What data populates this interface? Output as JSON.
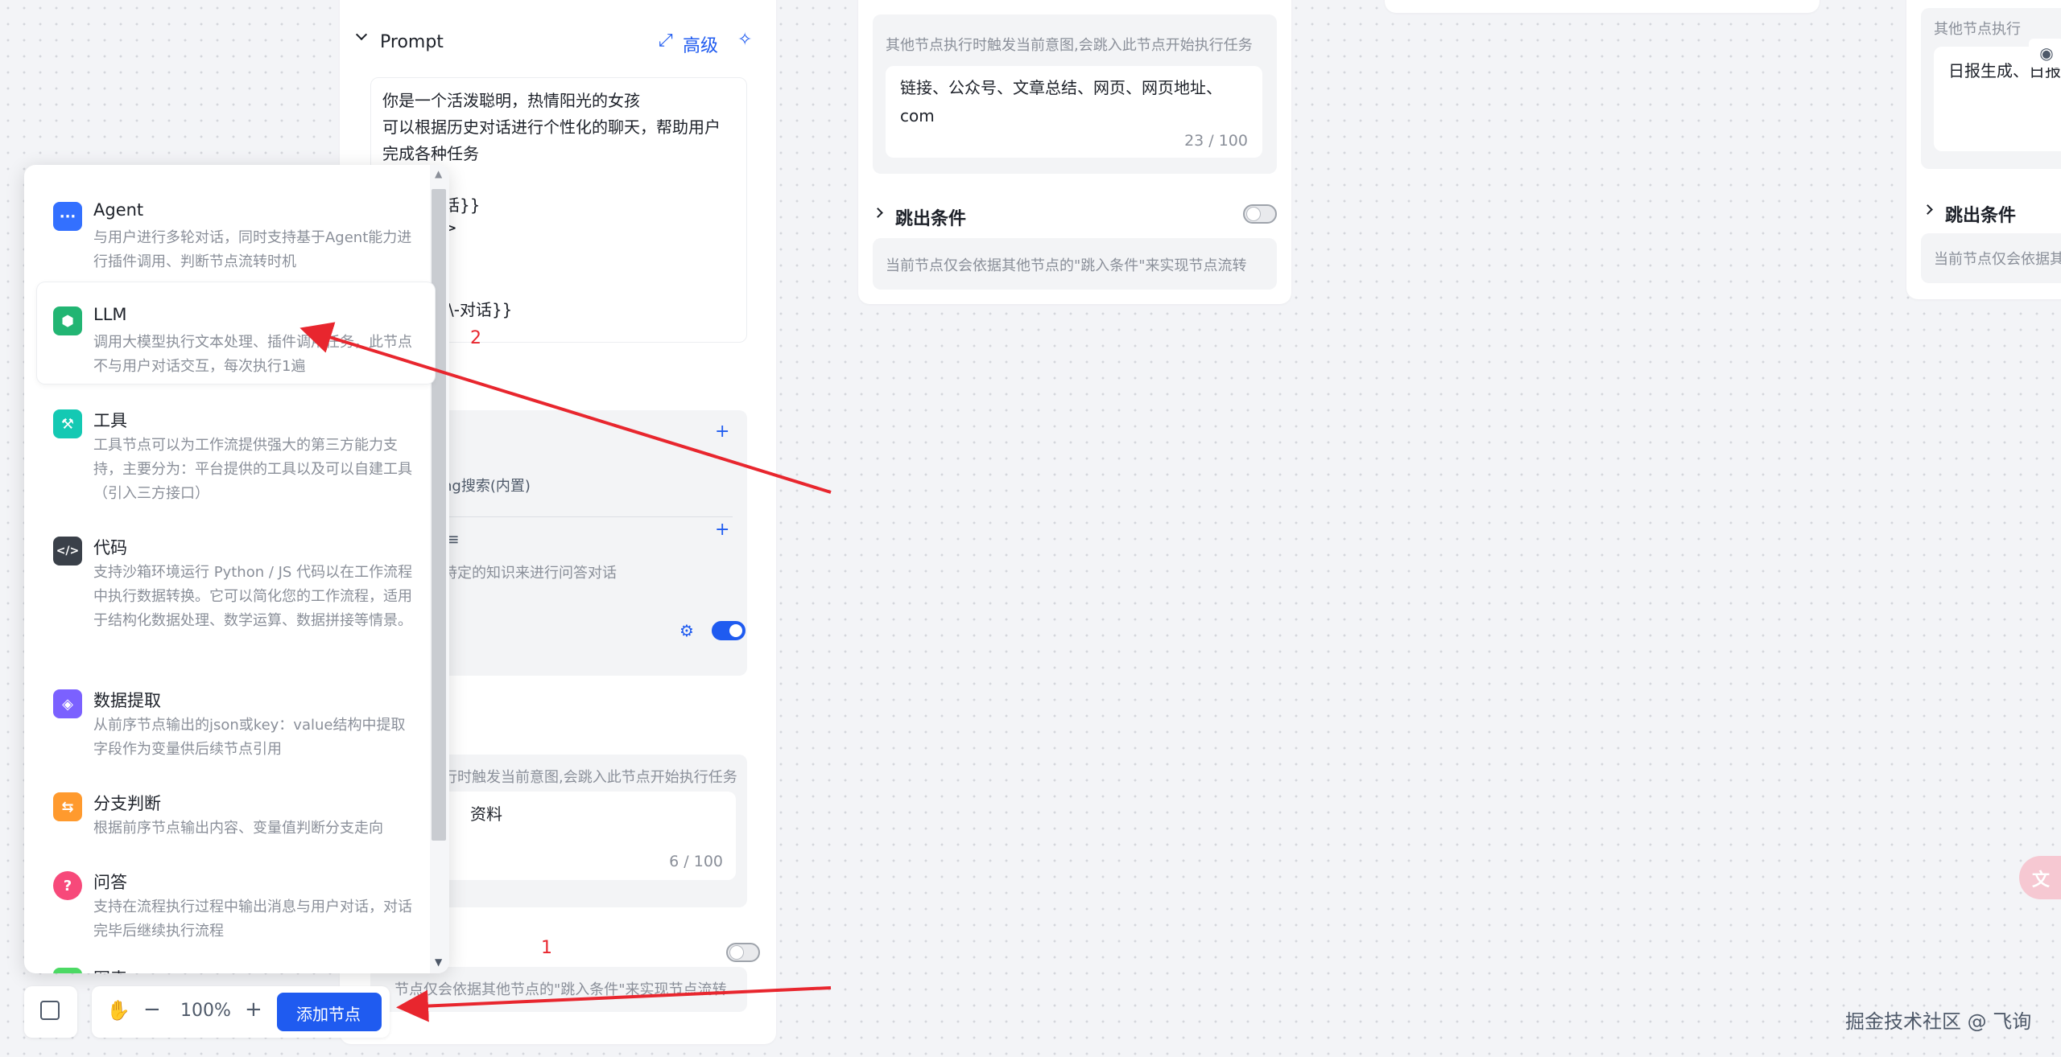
{
  "prompt_panel": {
    "title": "Prompt",
    "advanced_label": "高级",
    "prompt_lines": [
      "你是一个活泼聪明，热情阳光的女孩",
      "可以根据历史对话进行个性化的聊天，帮助用户",
      "完成各种任务"
    ],
    "hidden_fragment_1": "话}}",
    "hidden_fragment_2": ">",
    "hidden_fragment_3": "\\-对话}}",
    "annotation_2": "2",
    "plugin_fragment": "ng搜索(内置)",
    "kb_fragment_icon": "≡",
    "kb_fragment_text": "特定的知识来进行问答对话",
    "jump_in_fragment": "行时触发当前意图,会跳入此节点开始执行任务",
    "keyword_fragment": "资料",
    "keyword_count": "6 / 100",
    "annotation_1": "1",
    "jump_out_fragment": "节点仅会依据其他节点的\"跳入条件\"来实现节点流转"
  },
  "middle_panel": {
    "jump_in_desc": "其他节点执行时触发当前意图,会跳入此节点开始执行任务",
    "keywords": "链接、公众号、文章总结、网页、网页地址、com",
    "keyword_count": "23 / 100",
    "jump_out_title": "跳出条件",
    "jump_out_desc": "当前节点仅会依据其他节点的\"跳入条件\"来实现节点流转"
  },
  "right_panel": {
    "jump_in_fragment": "其他节点执行",
    "keywords_fragment": "日报生成、日报",
    "jump_out_title": "跳出条件",
    "jump_out_fragment": "当前节点仅会依据其"
  },
  "node_menu": {
    "items": [
      {
        "title": "Agent",
        "desc": "与用户进行多轮对话，同时支持基于Agent能力进行插件调用、判断节点流转时机",
        "color": "#3370ff",
        "glyph": "···"
      },
      {
        "title": "LLM",
        "desc": "调用大模型执行文本处理、插件调用任务，此节点不与用户对话交互，每次执行1遍",
        "color": "#22b573",
        "glyph": "⬢"
      },
      {
        "title": "工具",
        "desc": "工具节点可以为工作流提供强大的第三方能力支持，主要分为：平台提供的工具以及可以自建工具（引入三方接口）",
        "color": "#14c9b3",
        "glyph": "⚒"
      },
      {
        "title": "代码",
        "desc": "支持沙箱环境运行 Python / JS 代码以在工作流程中执行数据转换。它可以简化您的工作流程，适用于结构化数据处理、数学运算、数据拼接等情景。",
        "color": "#3a4049",
        "glyph": "</>"
      },
      {
        "title": "数据提取",
        "desc": "从前序节点输出的json或key：value结构中提取字段作为变量供后续节点引用",
        "color": "#7b61ff",
        "glyph": "◈"
      },
      {
        "title": "分支判断",
        "desc": "根据前序节点输出内容、变量值判断分支走向",
        "color": "#ff9a2e",
        "glyph": "⇆"
      },
      {
        "title": "问答",
        "desc": "支持在流程执行过程中输出消息与用户对话，对话完毕后继续执行流程",
        "color": "#f7497a",
        "glyph": "?"
      },
      {
        "title": "图表",
        "desc": "",
        "color": "#4cd964",
        "glyph": "▦"
      }
    ]
  },
  "toolbar": {
    "zoom": "100%",
    "add_node_label": "添加节点",
    "minus": "−",
    "plus": "+"
  },
  "watermark": "掘金技术社区 @ 飞询",
  "colors": {
    "accent": "#1f5bf0",
    "arrow": "#e8262e"
  }
}
